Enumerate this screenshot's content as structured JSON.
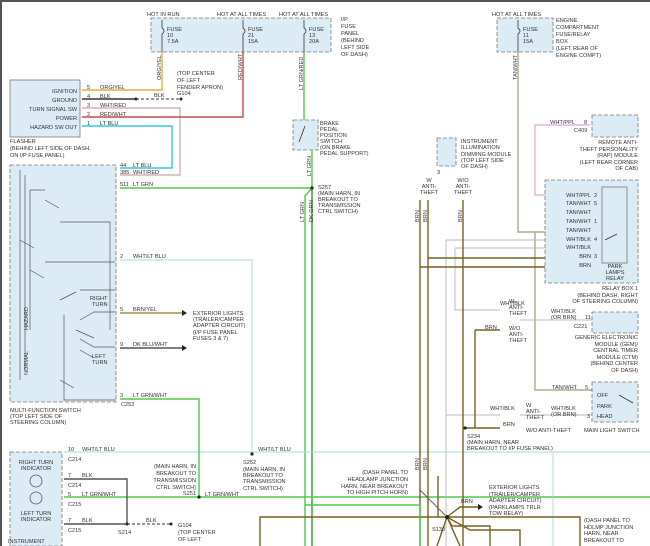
{
  "colors": {
    "org_yel": "#e0b040",
    "blk": "#333333",
    "wht_red": "#d8b0b0",
    "red_wht": "#c84848",
    "lt_blu": "#30c8e0",
    "lt_grn": "#50c850",
    "dk_grn": "#2a9a2a",
    "wht_lt_blu": "#a8d8dc",
    "brn_yel": "#a09040",
    "dk_blu_wht": "#555555",
    "brn": "#7a6020",
    "tan_wht": "#b0a888",
    "wht_blk": "#b8b8b8",
    "wht_ppl": "#d890d0",
    "component_fill": "#dcecf7"
  },
  "power": {
    "hot_in_run": "HOT IN RUN",
    "hot_at_all_times": "HOT AT ALL TIMES",
    "fuse_word": "FUSE",
    "fuses": [
      {
        "number": "10",
        "rating": "7.5A"
      },
      {
        "number": "21",
        "rating": "15A"
      },
      {
        "number": "13",
        "rating": "20A"
      },
      {
        "number": "11",
        "rating": "15A"
      }
    ],
    "ip_fuse_panel": [
      "I/P",
      "FUSE",
      "PANEL",
      "(BEHIND",
      "LEFT SIDE",
      "OF DASH)"
    ],
    "engine_box": [
      "ENGINE",
      "COMPARTMENT",
      "FUSE/RELAY",
      "BOX",
      "(LEFT REAR OF",
      "ENGINE COMPT)"
    ]
  },
  "flasher": {
    "pins": [
      {
        "label": "IGNITION",
        "pin": "5",
        "wire": "ORG/YEL"
      },
      {
        "label": "GROUND",
        "pin": "4",
        "wire": "BLK"
      },
      {
        "label": "TURN SIGNAL SW",
        "pin": "3",
        "wire": "WHT/RED"
      },
      {
        "label": "POWER",
        "pin": "2",
        "wire": "RED/WHT"
      },
      {
        "label": "HAZARD SW OUT",
        "pin": "1",
        "wire": "LT BLU"
      }
    ],
    "caption": [
      "FLASHER",
      "(BEHIND LEFT SIDE OF DASH,",
      "ON I/P FUSE PANEL)"
    ]
  },
  "ground_g104": {
    "wire": "BLK",
    "name": "G104",
    "location": [
      "(TOP CENTER",
      "OF LEFT",
      "FENDER APRON)"
    ]
  },
  "wire_labels": {
    "org_yel": "ORG/YEL",
    "red_wht": "RED/WHT",
    "lt_grn_red": "LT GRN/RED",
    "lt_grn": "LT GRN",
    "dk_grn": "DK GRN",
    "tan_wht": "TAN/WHT",
    "brn": "BRN"
  },
  "brake_switch": [
    "BRAKE",
    "PEDAL",
    "POSITION",
    "SWITCH",
    "(ON BRAKE",
    "PEDAL SUPPORT)"
  ],
  "multifunction": {
    "pins": [
      {
        "pin": "44",
        "wire": "LT BLU"
      },
      {
        "pin": "385",
        "wire": "WHT/RED"
      },
      {
        "pin": "511",
        "wire": "LT GRN"
      },
      {
        "pin": "2",
        "wire": "WHT/LT BLU"
      },
      {
        "pin": "5",
        "wire": "BRN/YEL"
      },
      {
        "pin": "9",
        "wire": "DK BLU/WHT"
      },
      {
        "pin": "3",
        "wire": "LT GRN/WHT"
      }
    ],
    "connector": "C253",
    "hazard": "HAZARD",
    "normal": "NORMAL",
    "right_turn": [
      "RIGHT",
      "TURN"
    ],
    "left_turn": [
      "LEFT",
      "TURN"
    ],
    "caption": [
      "MULTI-FUNCTION SWITCH",
      "(TOP LEFT SIDE OF",
      "STEERING COLUMN)"
    ]
  },
  "splices": {
    "s257": {
      "name": "S257",
      "desc": [
        "(MAIN HARN, IN",
        "BREAKOUT TO",
        "TRANSMISSION",
        "CTRL SWITCH)"
      ]
    },
    "s252": {
      "name": "S252",
      "desc": [
        "(MAIN HARN, IN",
        "BREAKOUT TO",
        "TRANSMISSION",
        "CTRL SWITCH)"
      ]
    },
    "s251": {
      "name": "S251",
      "desc": [
        "(MAIN HARN, IN",
        "BREAKOUT TO",
        "TRANSMISSION",
        "CTRL SWITCH)"
      ]
    },
    "s214": {
      "name": "S214"
    },
    "s234": {
      "name": "S234",
      "desc": [
        "(MAIN HARN, NEAR",
        "BREAKOUT TO I/P FUSE PANEL)"
      ]
    },
    "s130": {
      "name": "S130",
      "desc_left": [
        "(DASH PANEL TO",
        "HEADLAMP JUNCTION",
        "HARN, NEAR BREAKOUT",
        "TO HIGH PITCH HORN)"
      ],
      "desc_right": [
        "(DASH PANEL TO",
        "HDLMP JUNCTION",
        "HARN, NEAR",
        "BREAKOUT TO"
      ]
    }
  },
  "exterior_lights_1": [
    "EXTERIOR LIGHTS",
    "(TRAILER/CAMPER",
    "ADAPTER CIRCUIT)",
    "(I/P FUSE PANEL",
    "FUSES 3 & 7)"
  ],
  "exterior_lights_2": [
    "EXTERIOR LIGHTS",
    "(TRAILER/CAMPER",
    "ADAPTER CIRCUIT)",
    "(PARKLAMPS TRLR",
    "TOW RELAY)"
  ],
  "cluster": {
    "pins": [
      {
        "pin": "10",
        "wire": "WHT/LT BLU",
        "conn": "C214"
      },
      {
        "pin": "7",
        "wire": "BLK",
        "conn": "C214"
      },
      {
        "pin": "5",
        "wire": "LT GRN/WHT",
        "conn": "C215"
      },
      {
        "pin": "7",
        "wire": "BLK",
        "conn": "C215"
      }
    ],
    "right_indicator": [
      "RIGHT TURN",
      "INDICATOR"
    ],
    "left_indicator": [
      "LEFT TURN",
      "INDICATOR"
    ],
    "caption": "INSTRUMENT"
  },
  "dimming_module": {
    "pin": "3",
    "label": [
      "INSTRUMENT",
      "ILLUMINATION",
      "DIMMING MODULE",
      "(TOP LEFT SIDE",
      "OF DASH)"
    ]
  },
  "anti_theft": {
    "w": [
      "W",
      "ANTI-",
      "THEFT"
    ],
    "wo": [
      "W/O",
      "ANTI-",
      "THEFT"
    ],
    "wo_inline": "W/O ANTI-THEFT"
  },
  "rap_module": {
    "pin": "8",
    "wire": "WHT/PPL",
    "conn": "C409",
    "label": [
      "REMOTE ANTI-",
      "THEFT PERSONALITY",
      "(RAP) MODULE",
      "(LEFT REAR CORNER",
      "OF CAB)"
    ]
  },
  "relay_box": {
    "pins": [
      {
        "wire": "WHT/PPL",
        "pin": "2"
      },
      {
        "wire": "TAN/WHT",
        "pin": "5"
      },
      {
        "wire": "TAN/WHT",
        "pin": ""
      },
      {
        "wire": "TAN/WHT",
        "pin": "1"
      },
      {
        "wire": "TAN/WHT",
        "pin": ""
      },
      {
        "wire": "WHT/BLK",
        "pin": "4"
      },
      {
        "wire": "WHT/BLK",
        "pin": ""
      },
      {
        "wire": "BRN",
        "pin": "3"
      },
      {
        "wire": "BRN",
        "pin": ""
      }
    ],
    "relay": [
      "PARK",
      "LAMPS",
      "RELAY"
    ],
    "caption": [
      "RELAY BOX 1",
      "(BEHIND DASH, RIGHT",
      "OF STEERING COLUMN)"
    ]
  },
  "gem": {
    "wire": [
      "WHT/BLK",
      "(OR BRN)"
    ],
    "pin": "11",
    "conn": "C221",
    "wht_blk": "WHT/BLK",
    "brn": "BRN",
    "label": [
      "GENERIC ELECTRONIC",
      "MODULE (GEM)/",
      "CENTRAL TIMER",
      "MODULE (CTM)",
      "(BEHIND CENTER",
      "OF DASH)"
    ]
  },
  "main_light_switch": {
    "tan_pin": "5",
    "tan_wire": "TAN/WHT",
    "pin": "3",
    "wire": [
      "WHT/BLK",
      "(OR BRN)"
    ],
    "wht_blk": "WHT/BLK",
    "brn": "BRN",
    "positions": [
      "OFF",
      "PARK",
      "HEAD"
    ],
    "caption": "MAIN LIGHT SWITCH"
  }
}
